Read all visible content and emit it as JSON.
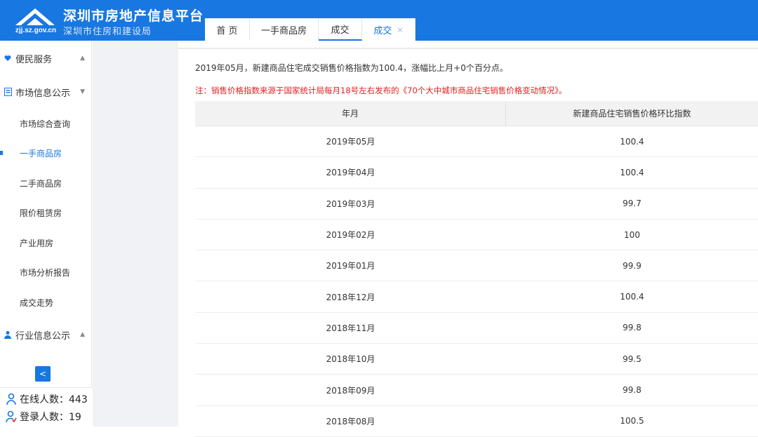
{
  "header": {
    "logo_url": "zjj.sz.gov.cn",
    "title": "深圳市房地产信息平台",
    "subtitle": "深圳市住房和建设局"
  },
  "tabs": [
    {
      "label": "首 页"
    },
    {
      "label": "一手商品房"
    },
    {
      "label": "成交"
    },
    {
      "label": "成交",
      "close": "×"
    }
  ],
  "sidebar": {
    "groups": [
      {
        "label": "便民服务",
        "caret": "▲"
      },
      {
        "label": "市场信息公示",
        "caret": "▼"
      },
      {
        "label": "行业信息公示",
        "caret": "▲"
      }
    ],
    "items": [
      {
        "label": "市场综合查询"
      },
      {
        "label": "一手商品房"
      },
      {
        "label": "二手商品房"
      },
      {
        "label": "限价租赁房"
      },
      {
        "label": "产业用房"
      },
      {
        "label": "市场分析报告"
      },
      {
        "label": "成交走势"
      }
    ],
    "collapse_label": "<",
    "online_label": "在线人数：443",
    "login_label": "登录人数：19"
  },
  "main": {
    "summary": "2019年05月，新建商品住宅成交销售价格指数为100.4，涨幅比上月+0个百分点。",
    "note": "注：销售价格指数来源于国家统计局每月18号左右发布的《70个大中城市商品住宅销售价格变动情况》。",
    "columns": [
      "年月",
      "新建商品住宅销售价格环比指数"
    ],
    "rows": [
      [
        "2019年05月",
        "100.4"
      ],
      [
        "2019年04月",
        "100.4"
      ],
      [
        "2019年03月",
        "99.7"
      ],
      [
        "2019年02月",
        "100"
      ],
      [
        "2019年01月",
        "99.9"
      ],
      [
        "2018年12月",
        "100.4"
      ],
      [
        "2018年11月",
        "99.8"
      ],
      [
        "2018年10月",
        "99.5"
      ],
      [
        "2018年09月",
        "99.8"
      ],
      [
        "2018年08月",
        "100.5"
      ]
    ]
  },
  "colors": {
    "brand": "#1877e0",
    "note": "#e02020"
  }
}
